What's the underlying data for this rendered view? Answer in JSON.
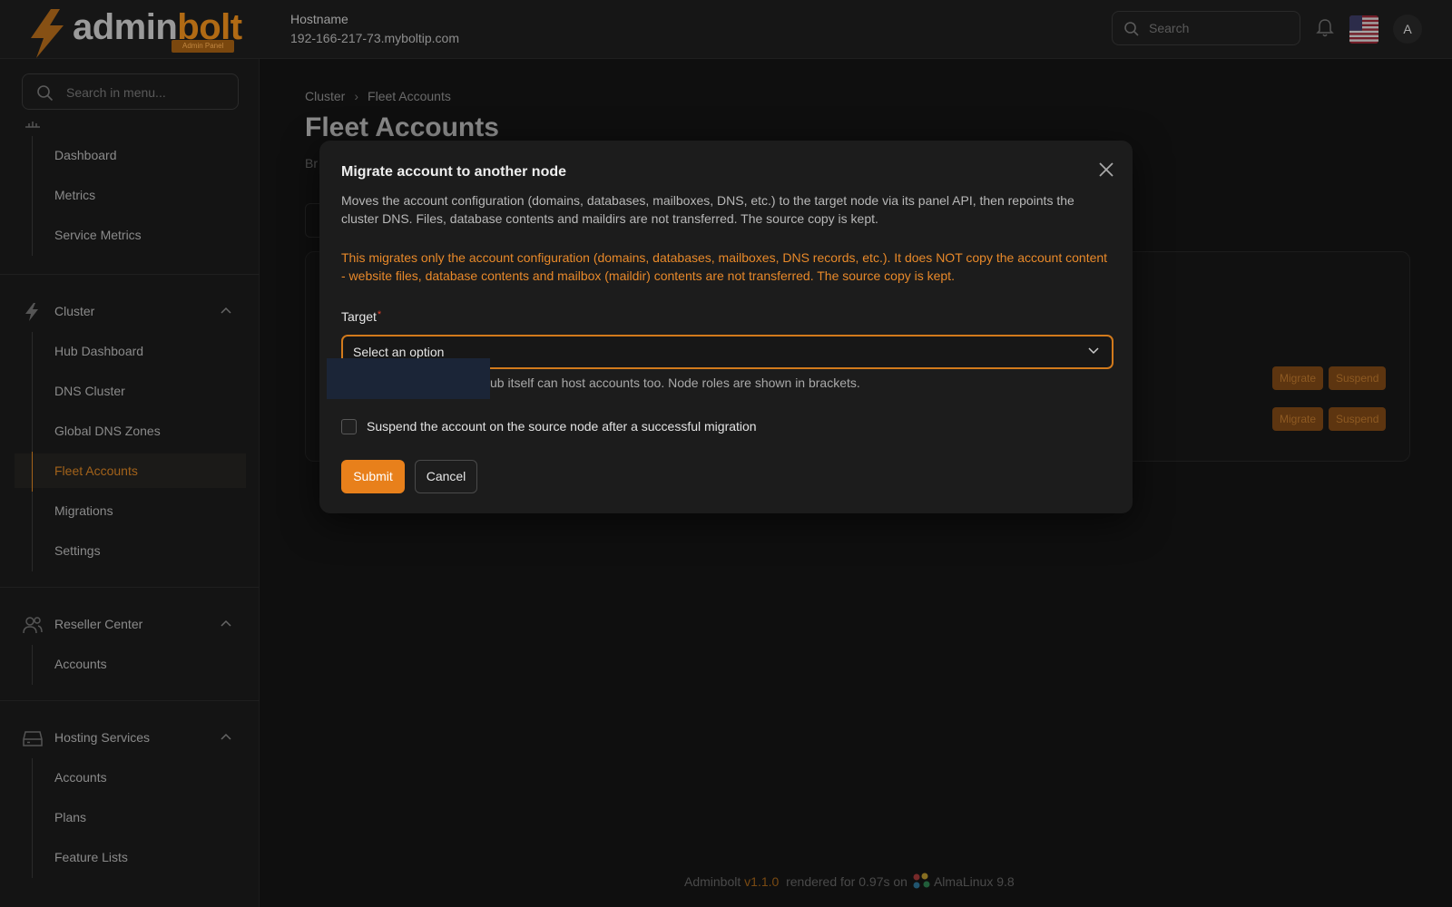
{
  "brand": {
    "name_part1": "admin",
    "name_part2": "bolt",
    "badge": "Admin Panel"
  },
  "header": {
    "host_label": "Hostname",
    "host_value": "192-166-217-73.myboltip.com",
    "search_placeholder": "Search",
    "avatar_initial": "A",
    "accent_color": "#e8801b"
  },
  "sidebar": {
    "search_placeholder": "Search in menu...",
    "items_top": [
      {
        "label": "Dashboard"
      },
      {
        "label": "Metrics"
      },
      {
        "label": "Service Metrics"
      }
    ],
    "groups": [
      {
        "label": "Cluster",
        "icon": "bolt-icon",
        "items": [
          {
            "label": "Hub Dashboard"
          },
          {
            "label": "DNS Cluster"
          },
          {
            "label": "Global DNS Zones"
          },
          {
            "label": "Fleet Accounts",
            "active": true
          },
          {
            "label": "Migrations"
          },
          {
            "label": "Settings"
          }
        ]
      },
      {
        "label": "Reseller Center",
        "icon": "users-icon",
        "items": [
          {
            "label": "Accounts"
          }
        ]
      },
      {
        "label": "Hosting Services",
        "icon": "server-icon",
        "items": [
          {
            "label": "Accounts"
          },
          {
            "label": "Plans"
          },
          {
            "label": "Feature Lists"
          }
        ]
      }
    ]
  },
  "main": {
    "breadcrumb": [
      "Cluster",
      "Fleet Accounts"
    ],
    "title": "Fleet Accounts",
    "subtitle_fragment": "Br",
    "row_actions": [
      {
        "migrate": "Migrate",
        "suspend": "Suspend"
      },
      {
        "migrate": "Migrate",
        "suspend": "Suspend"
      }
    ]
  },
  "modal": {
    "title": "Migrate account to another node",
    "description": "Moves the account configuration (domains, databases, mailboxes, DNS, etc.) to the target node via its panel API, then repoints the cluster DNS. Files, database contents and maildirs are not transferred. The source copy is kept.",
    "warning": "This migrates only the account configuration (domains, databases, mailboxes, DNS records, etc.). It does NOT copy the account content - website files, database contents and mailbox (maildir) contents are not transferred. The source copy is kept.",
    "target_label": "Target",
    "target_placeholder": "Select an option",
    "helper_text": "ub itself can host accounts too. Node roles are shown in brackets.",
    "checkbox_label": "Suspend the account on the source node after a successful migration",
    "submit_label": "Submit",
    "cancel_label": "Cancel"
  },
  "footer": {
    "product": "Adminbolt",
    "version": "v1.1.0",
    "render_text": "rendered for 0.97s on",
    "os": "AlmaLinux 9.8"
  }
}
